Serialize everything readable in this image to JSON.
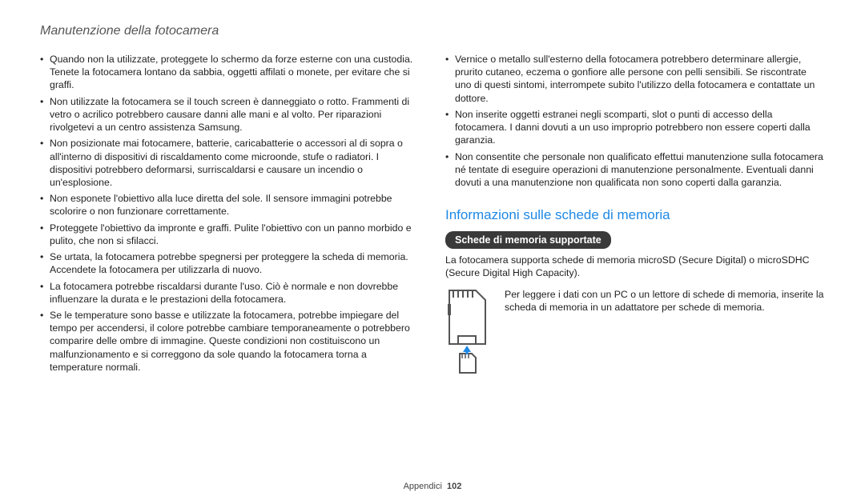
{
  "header": {
    "section_title": "Manutenzione della fotocamera"
  },
  "left_bullets": [
    "Quando non la utilizzate, proteggete lo schermo da forze esterne con una custodia. Tenete la fotocamera lontano da sabbia, oggetti affilati o monete, per evitare che si graffi.",
    "Non utilizzate la fotocamera se il touch screen è danneggiato o rotto. Frammenti di vetro o acrilico potrebbero causare danni alle mani e al volto. Per riparazioni rivolgetevi a un centro assistenza Samsung.",
    "Non posizionate mai fotocamere, batterie, caricabatterie o accessori al di sopra o all'interno di dispositivi di riscaldamento come microonde, stufe o radiatori. I dispositivi potrebbero deformarsi, surriscaldarsi e causare un incendio o un'esplosione.",
    "Non esponete l'obiettivo alla luce diretta del sole. Il sensore immagini potrebbe scolorire o non funzionare correttamente.",
    "Proteggete l'obiettivo da impronte e graffi. Pulite l'obiettivo con un panno morbido e pulito, che non si sfilacci.",
    "Se urtata, la fotocamera potrebbe spegnersi per proteggere la scheda di memoria. Accendete la fotocamera per utilizzarla di nuovo.",
    "La fotocamera potrebbe riscaldarsi durante l'uso. Ciò è normale e non dovrebbe influenzare la durata e le prestazioni della fotocamera.",
    "Se le temperature sono basse e utilizzate la fotocamera, potrebbe impiegare del tempo per accendersi, il colore potrebbe cambiare temporaneamente o potrebbero comparire delle ombre di immagine. Queste condizioni non costituiscono un malfunzionamento e si correggono da sole quando la fotocamera torna a temperature normali."
  ],
  "right_bullets": [
    "Vernice o metallo sull'esterno della fotocamera potrebbero determinare allergie, prurito cutaneo, eczema o gonfiore alle persone con pelli sensibili. Se riscontrate uno di questi sintomi, interrompete subito l'utilizzo della fotocamera e contattate un dottore.",
    "Non inserite oggetti estranei negli scomparti, slot o punti di accesso della fotocamera. I danni dovuti a un uso improprio potrebbero non essere coperti dalla garanzia.",
    "Non consentite che personale non qualificato effettui manutenzione sulla fotocamera né tentate di eseguire operazioni di manutenzione personalmente. Eventuali danni dovuti a una manutenzione non qualificata non sono coperti dalla garanzia."
  ],
  "memory": {
    "heading": "Informazioni sulle schede di memoria",
    "pill": "Schede di memoria supportate",
    "support_text": "La fotocamera supporta schede di memoria microSD (Secure Digital) o microSDHC (Secure Digital High Capacity).",
    "adapter_text": "Per leggere i dati con un PC o un lettore di schede di memoria, inserite la scheda di memoria in un adattatore per schede di memoria."
  },
  "footer": {
    "label": "Appendici",
    "page": "102"
  }
}
